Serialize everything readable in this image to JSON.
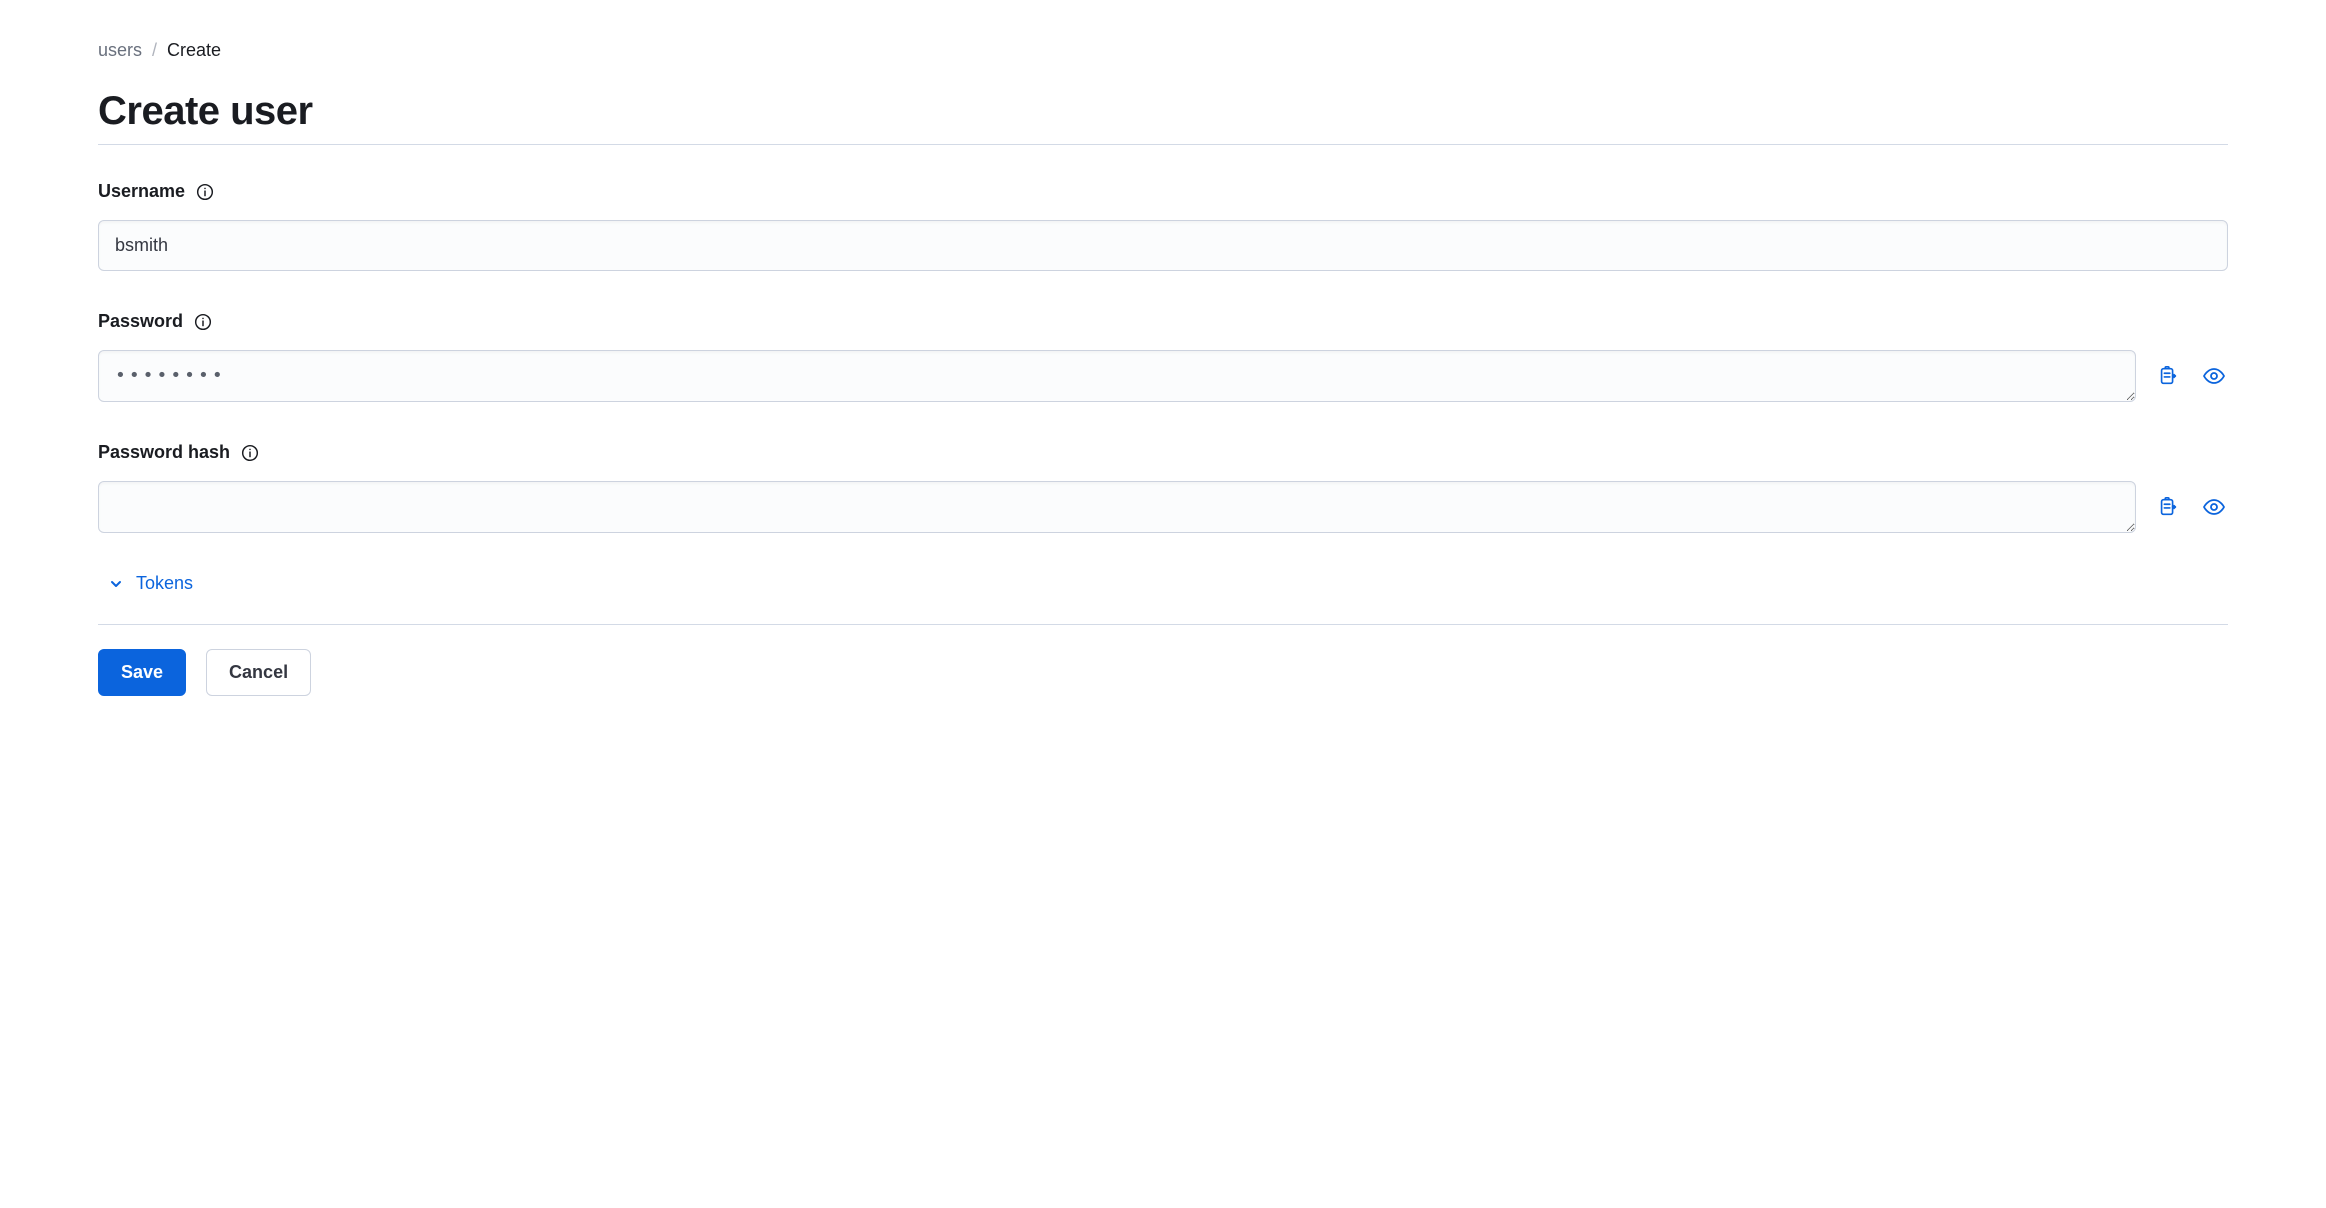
{
  "breadcrumb": {
    "parent": "users",
    "separator": "/",
    "current": "Create"
  },
  "page": {
    "title": "Create user"
  },
  "fields": {
    "username": {
      "label": "Username",
      "value": "bsmith"
    },
    "password": {
      "label": "Password",
      "value": "••••••••"
    },
    "password_hash": {
      "label": "Password hash",
      "value": ""
    }
  },
  "collapsible": {
    "tokens_label": "Tokens"
  },
  "actions": {
    "save": "Save",
    "cancel": "Cancel"
  }
}
